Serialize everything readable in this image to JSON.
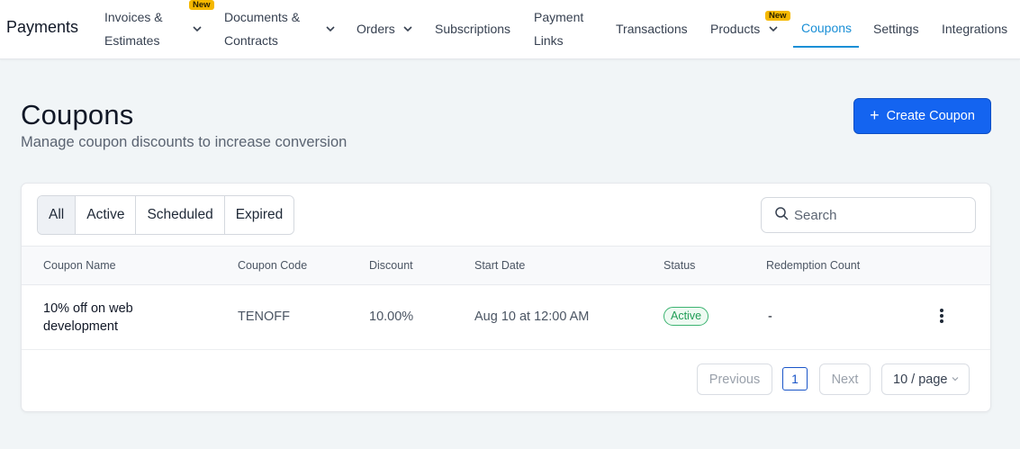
{
  "nav": {
    "brand": "Payments",
    "items": [
      {
        "line1": "Invoices &",
        "line2": "Estimates",
        "badge": "New"
      },
      {
        "line1": "Documents &",
        "line2": "Contracts"
      },
      {
        "label": "Orders"
      },
      {
        "label": "Subscriptions"
      },
      {
        "line1": "Payment",
        "line2": "Links"
      },
      {
        "label": "Transactions"
      },
      {
        "label": "Products",
        "badge": "New"
      },
      {
        "label": "Coupons"
      },
      {
        "label": "Settings"
      },
      {
        "label": "Integrations"
      }
    ]
  },
  "header": {
    "title": "Coupons",
    "subtitle": "Manage coupon discounts to increase conversion",
    "create_button": "Create Coupon"
  },
  "filters": {
    "tabs": [
      "All",
      "Active",
      "Scheduled",
      "Expired"
    ],
    "selected": "All"
  },
  "search": {
    "placeholder": "Search"
  },
  "table": {
    "columns": [
      "Coupon Name",
      "Coupon Code",
      "Discount",
      "Start Date",
      "Status",
      "Redemption Count"
    ],
    "rows": [
      {
        "name_line1": "10% off on web",
        "name_line2": "development",
        "code": "TENOFF",
        "discount": "10.00%",
        "start_date": "Aug 10 at 12:00 AM",
        "status": "Active",
        "redemption_count": "-"
      }
    ]
  },
  "pagination": {
    "previous": "Previous",
    "current_page": "1",
    "next": "Next",
    "page_size": "10 / page"
  },
  "colors": {
    "accent": "#1464f0",
    "active_tab": "#1a8fd6",
    "badge": "#f5b800",
    "status_active": "#1f9d55"
  }
}
